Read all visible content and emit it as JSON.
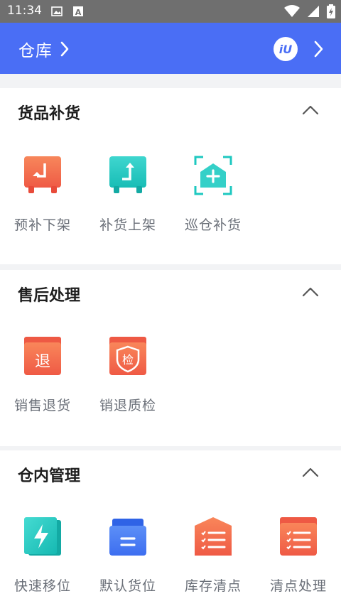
{
  "status_bar": {
    "time": "11:34"
  },
  "app_bar": {
    "title": "仓库",
    "logo_text": "iU"
  },
  "sections": [
    {
      "title": "货品补货",
      "items": [
        {
          "label": "预补下架",
          "icon": "shelf-down-icon"
        },
        {
          "label": "补货上架",
          "icon": "shelf-up-icon"
        },
        {
          "label": "巡仓补货",
          "icon": "warehouse-scan-icon"
        }
      ]
    },
    {
      "title": "售后处理",
      "items": [
        {
          "label": "销售退货",
          "icon": "return-icon",
          "glyph": "退"
        },
        {
          "label": "销退质检",
          "icon": "inspection-icon",
          "glyph": "检"
        }
      ]
    },
    {
      "title": "仓内管理",
      "items": [
        {
          "label": "快速移位",
          "icon": "quick-move-icon"
        },
        {
          "label": "默认货位",
          "icon": "default-location-icon"
        },
        {
          "label": "库存清点",
          "icon": "stock-count-icon"
        },
        {
          "label": "清点处理",
          "icon": "count-process-icon"
        }
      ]
    }
  ],
  "colors": {
    "brand_blue": "#4a6ef5",
    "orange": "#f2704d",
    "teal": "#1ec8c0"
  }
}
